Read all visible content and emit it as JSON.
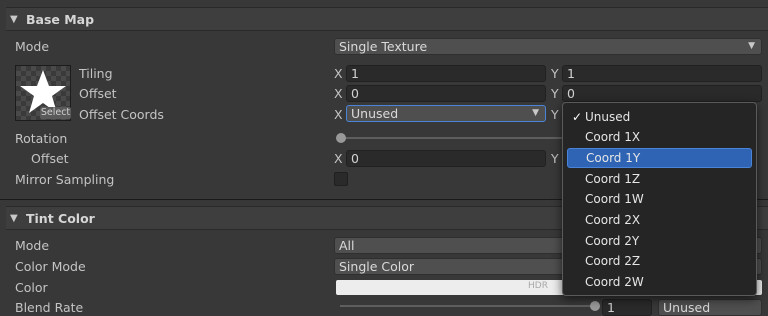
{
  "base_map": {
    "title": "Base Map",
    "mode": {
      "label": "Mode",
      "value": "Single Texture"
    },
    "texture": {
      "select_label": "Select"
    },
    "tiling": {
      "label": "Tiling",
      "x_axis": "X",
      "x": "1",
      "y_axis": "Y",
      "y": "1"
    },
    "offset": {
      "label": "Offset",
      "x_axis": "X",
      "x": "0",
      "y_axis": "Y",
      "y": "0"
    },
    "offset_coords": {
      "label": "Offset Coords",
      "x_axis": "X",
      "x_value": "Unused",
      "y_axis": "Y"
    },
    "rotation": {
      "label": "Rotation",
      "level": 0
    },
    "rotation_offset": {
      "label": "Offset",
      "x_axis": "X",
      "x": "0",
      "y_axis": "Y"
    },
    "mirror_sampling": {
      "label": "Mirror Sampling",
      "checked": false
    }
  },
  "tint_color": {
    "title": "Tint Color",
    "mode": {
      "label": "Mode",
      "value": "All"
    },
    "color_mode": {
      "label": "Color Mode",
      "value": "Single Color"
    },
    "color": {
      "label": "Color",
      "hdr": "HDR",
      "swatch": "#ededed"
    },
    "blend_rate": {
      "label": "Blend Rate",
      "value": "1",
      "dropdown": "Unused"
    }
  },
  "dropdown_menu": {
    "selected": "Coord 1Y",
    "items": [
      {
        "label": "Unused",
        "check": "✓"
      },
      {
        "label": "Coord 1X",
        "check": ""
      },
      {
        "label": "Coord 1Y",
        "check": ""
      },
      {
        "label": "Coord 1Z",
        "check": ""
      },
      {
        "label": "Coord 1W",
        "check": ""
      },
      {
        "label": "Coord 2X",
        "check": ""
      },
      {
        "label": "Coord 2Y",
        "check": ""
      },
      {
        "label": "Coord 2Z",
        "check": ""
      },
      {
        "label": "Coord 2W",
        "check": ""
      }
    ]
  },
  "colors": {
    "background": "#383838",
    "highlight": "#2f64b4",
    "field": "#2a2a2a"
  }
}
